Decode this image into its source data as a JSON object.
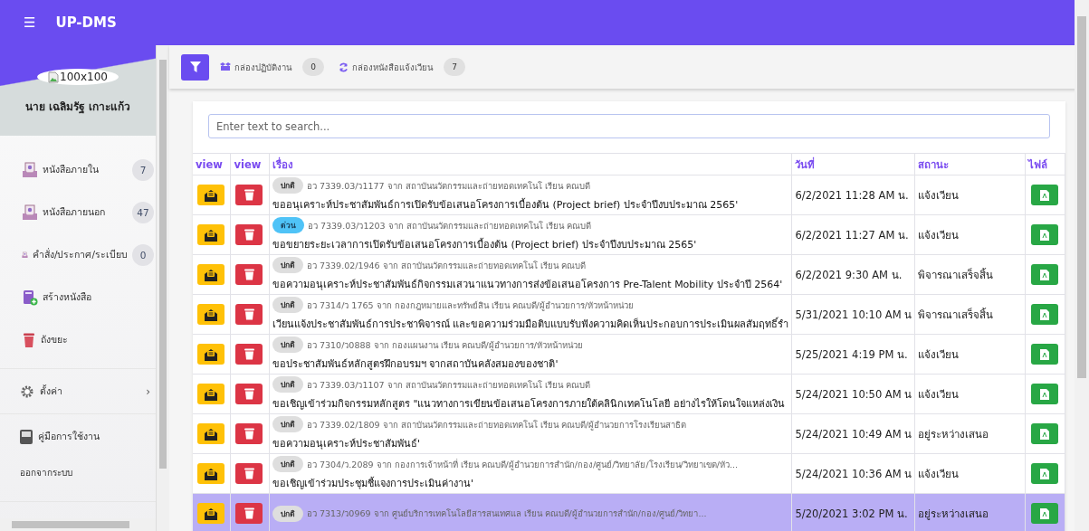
{
  "app_bar": {
    "menu_icon": "☰",
    "title": "UP-DMS"
  },
  "sidebar": {
    "avatar_alt": "100x100",
    "user_name": "นาย เฉลิมรัฐ เกาะแก้ว",
    "items": [
      {
        "kind": "inbox",
        "label": "หนังสือภายใน",
        "count": "7"
      },
      {
        "kind": "inbox",
        "label": "หนังสือภายนอก",
        "count": "47"
      },
      {
        "kind": "inbox",
        "label": "คำสั่ง/ประกาศ/ระเบียบ",
        "count": "0"
      },
      {
        "kind": "create",
        "label": "สร้างหนังสือ"
      },
      {
        "kind": "trash",
        "label": "ถังขยะ"
      }
    ],
    "settings": {
      "label": "ตั้งค่า",
      "chevron": "›"
    },
    "manual": {
      "label": "คู่มือการใช้งาน"
    },
    "logout": {
      "label": "ออกจากระบบ"
    }
  },
  "toolbar": {
    "boxes": [
      {
        "kind": "work",
        "label": "กล่องปฏิบัติงาน",
        "count": "0"
      },
      {
        "kind": "circular",
        "label": "กล่องหนังสือแจ้งเวียน",
        "count": "7"
      }
    ]
  },
  "search": {
    "placeholder": "Enter text to search..."
  },
  "table": {
    "columns": [
      "view",
      "view",
      "เรื่อง",
      "วันที่",
      "สถานะ",
      "ไฟล์"
    ],
    "rows": [
      {
        "selected": false,
        "priority": {
          "kind": "normal",
          "label": "ปกติ"
        },
        "reference": "อว 7339.03/ว1177 จาก สถาบันนวัตกรรมและถ่ายทอดเทคโนโ เรียน คณบดี",
        "title": "ขออนุเคราะห์ประชาสัมพันธ์การเปิดรับข้อเสนอโครงการเบื้องต้น (Project brief) ประจำปีงบประมาณ 2565'",
        "date": "6/2/2021 11:28 AM น.",
        "status": "แจ้งเวียน"
      },
      {
        "selected": false,
        "priority": {
          "kind": "urgent",
          "label": "ด่วน"
        },
        "reference": "อว 7339.03/ว1203 จาก สถาบันนวัตกรรมและถ่ายทอดเทคโนโ เรียน คณบดี",
        "title": "ขอขยายระยะเวลาการเปิดรับข้อเสนอโครงการเบื้องต้น (Project brief) ประจำปีงบประมาณ 2565'",
        "date": "6/2/2021 11:27 AM น.",
        "status": "แจ้งเวียน"
      },
      {
        "selected": false,
        "priority": {
          "kind": "normal",
          "label": "ปกติ"
        },
        "reference": "อว 7339.02/1946 จาก สถาบันนวัตกรรมและถ่ายทอดเทคโนโ เรียน คณบดี",
        "title": "ขอความอนุเคราะห์ประชาสัมพันธ์กิจกรรมเสวนาแนวทางการส่งข้อเสนอโครงการ Pre-Talent Mobility ประจำปี 2564'",
        "date": "6/2/2021 9:30 AM น.",
        "status": "พิจารณาเสร็จสิ้น"
      },
      {
        "selected": false,
        "priority": {
          "kind": "normal",
          "label": "ปกติ"
        },
        "reference": "อว 7314/ว 1765 จาก กองกฎหมายและทรัพย์สิน เรียน คณบดี/ผู้อำนวยการ/หัวหน้าหน่วย",
        "title": "เวียนแจ้งประชาสัมพันธ์การประชาพิจารณ์ และขอความร่วมมือติบแบบรับฟังความคิดเห็นประกอบการประเมินผลสัมฤทธิ์รำ",
        "date": "5/31/2021 10:10 AM น",
        "status": "พิจารณาเสร็จสิ้น"
      },
      {
        "selected": false,
        "priority": {
          "kind": "normal",
          "label": "ปกติ"
        },
        "reference": "อว 7310/ว0888 จาก กองแผนงาน เรียน คณบดี/ผู้อำนวยการ/หัวหน้าหน่วย",
        "title": "ขอประชาสัมพันธ์หลักสูตรฝึกอบรมฯ จากสถาบันคลังสมองของชาติ'",
        "date": "5/25/2021 4:19 PM น.",
        "status": "แจ้งเวียน"
      },
      {
        "selected": false,
        "priority": {
          "kind": "normal",
          "label": "ปกติ"
        },
        "reference": "อว 7339.03/ว1107 จาก สถาบันนวัตกรรมและถ่ายทอดเทคโนโ เรียน คณบดี",
        "title": "ขอเชิญเข้าร่วมกิจกรรมหลักสูตร \"แนวทางการเขียนข้อเสนอโครงการภายใต้คลินิกเทคโนโลยี อย่างไรให้โดนใจแหล่งเงิน",
        "date": "5/24/2021 10:50 AM น",
        "status": "แจ้งเวียน"
      },
      {
        "selected": false,
        "priority": {
          "kind": "normal",
          "label": "ปกติ"
        },
        "reference": "อว 7339.02/1809 จาก สถาบันนวัตกรรมและถ่ายทอดเทคโนโ เรียน คณบดี/ผู้อำนวยการโรงเรียนสาธิต",
        "title": "ขอความอนุเคราะห์ประชาสัมพันธ์'",
        "date": "5/24/2021 10:49 AM น",
        "status": "อยู่ระหว่างเสนอ"
      },
      {
        "selected": false,
        "priority": {
          "kind": "normal",
          "label": "ปกติ"
        },
        "reference": "อว 7304/ว.2089 จาก กองการเจ้าหน้าที่ เรียน คณบดี/ผู้อำนวยการสำนัก/กอง/ศูนย์/วิทยาลัย/โรงเรียน/วิทยาเขต/หัว...",
        "title": "ขอเชิญเข้าร่วมประชุมชี้แจงการประเมินค่างาน'",
        "date": "5/24/2021 10:36 AM น",
        "status": "แจ้งเวียน"
      },
      {
        "selected": true,
        "priority": {
          "kind": "normal",
          "label": "ปกติ"
        },
        "reference": "อว 7313/ว0969 จาก ศูนย์บริการเทคโนโลยีสารสนเทศแล เรียน คณบดี/ผู้อำนวยการสำนัก/กอง/ศูนย์/วิทยา...",
        "date": "5/20/2021 3:02 PM น.",
        "status": "อยู่ระหว่างเสนอ"
      }
    ]
  }
}
